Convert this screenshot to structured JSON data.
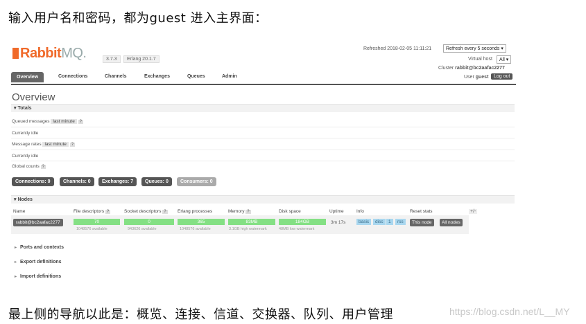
{
  "intro_text": "输入用户名和密码，都为guest 进入主界面：",
  "outro_text": "最上侧的导航以此是：概览、连接、信道、交换器、队列、用户管理",
  "watermark": "https://blog.csdn.net/L__MY",
  "brand": {
    "rabbit": "Rabbit",
    "mq": "MQ.",
    "version": "3.7.3",
    "erlang": "Erlang 20.1.7",
    "color": "#f06a2a"
  },
  "header": {
    "refreshed_label": "Refreshed 2018-02-05 11:11:21",
    "refresh_select": "Refresh every 5 seconds",
    "vhost_label": "Virtual host",
    "vhost_select": "All",
    "cluster_label": "Cluster",
    "cluster_value": "rabbit@bc2aafac2277",
    "user_label": "User",
    "user_value": "guest",
    "logout": "Log out"
  },
  "tabs": [
    "Overview",
    "Connections",
    "Channels",
    "Exchanges",
    "Queues",
    "Admin"
  ],
  "overview": {
    "title": "Overview",
    "totals_label": "Totals",
    "queued_label": "Queued messages",
    "last_minute": "last minute",
    "help": "?",
    "idle": "Currently idle",
    "rates_label": "Message rates",
    "global_label": "Global counts"
  },
  "counts": [
    "Connections: 0",
    "Channels: 0",
    "Exchanges: 7",
    "Queues: 0",
    "Consumers: 0"
  ],
  "nodes": {
    "label": "Nodes",
    "headers": [
      "Name",
      "File descriptors",
      "Socket descriptors",
      "Erlang processes",
      "Memory",
      "Disk space",
      "Uptime",
      "Info",
      "Reset stats"
    ],
    "help": "?",
    "plus_minus": "+/-",
    "row": {
      "name": "rabbit@bc2aafac2277",
      "fd": "70",
      "fd_sub": "1048576 available",
      "sd": "0",
      "sd_sub": "943626 available",
      "ep": "365",
      "ep_sub": "1048576 available",
      "mem": "83MB",
      "mem_sub": "3.1GB high watermark",
      "disk": "184GB",
      "disk_sub": "48MB low watermark",
      "uptime": "3m 17s",
      "info": [
        "basic",
        "disc",
        "1",
        "rss"
      ],
      "this_node": "This node",
      "all_nodes": "All nodes"
    }
  },
  "collapsed": [
    "Ports and contexts",
    "Export definitions",
    "Import definitions"
  ]
}
